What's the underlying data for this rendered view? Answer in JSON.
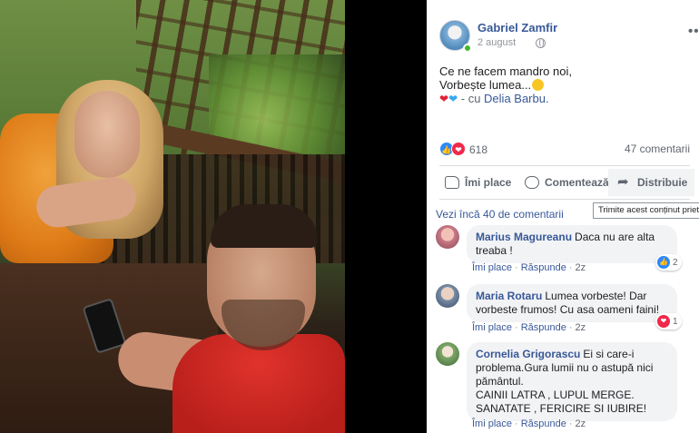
{
  "post": {
    "author": "Gabriel Zamfir",
    "date": "2 august",
    "text_line1": "Ce ne facem mandro noi,",
    "text_line2": "Vorbește lumea...",
    "with_label": "- cu",
    "tagged": "Delia Barbu.",
    "reaction_count": "618",
    "comments_count": "47 comentarii"
  },
  "actions": {
    "like": "Îmi place",
    "comment": "Comentează",
    "share": "Distribuie"
  },
  "tooltip": "Trimite acest conținut prieten",
  "view_more": "Vezi încă 40 de comentarii",
  "comment_meta": {
    "like": "Îmi place",
    "reply": "Răspunde",
    "time": "2z"
  },
  "comments": [
    {
      "author": "Marius Magureanu",
      "text": "Daca nu are alta treaba !",
      "reactions": "2",
      "reaction_type": "like-icon"
    },
    {
      "author": "Maria Rotaru",
      "text": "Lumea vorbeste! Dar vorbeste frumos! Cu asa oameni faini!",
      "reactions": "1",
      "reaction_type": "heart-icon"
    },
    {
      "author": "Cornelia Grigorascu",
      "text": "Ei si care-i problema.Gura lumii nu o astupă nici pământul.",
      "text2": "CAINII LATRA , LUPUL MERGE.",
      "text3": "SANATATE , FERICIRE SI IUBIRE!"
    }
  ],
  "colors": {
    "link": "#385898",
    "like_blue": "#2d88ff",
    "love_red": "#f0284a",
    "bubble_bg": "#f2f3f5"
  }
}
